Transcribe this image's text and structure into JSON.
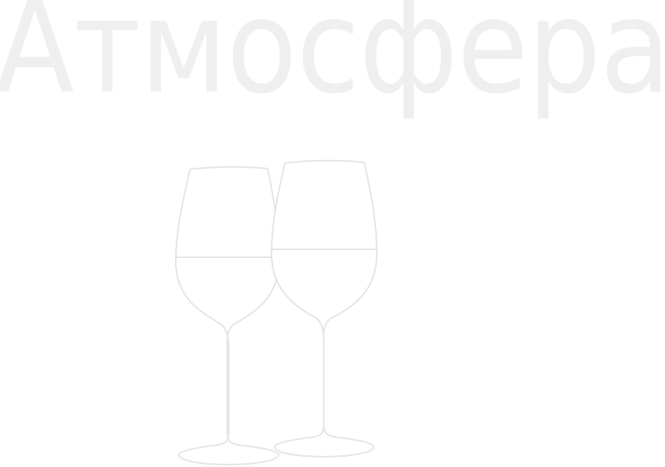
{
  "title": "Атмосфера",
  "illustration": {
    "icon": "wine-glasses-icon",
    "line_color": "#e5e5e5"
  }
}
